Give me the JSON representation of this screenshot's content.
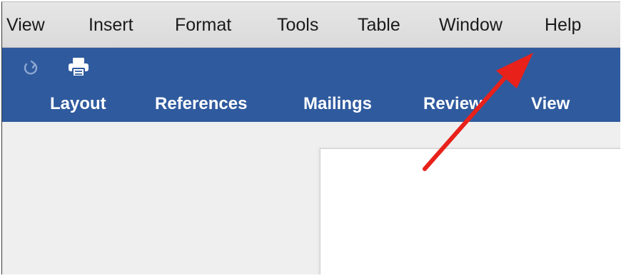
{
  "menubar": {
    "items": [
      "View",
      "Insert",
      "Format",
      "Tools",
      "Table",
      "Window",
      "Help"
    ]
  },
  "toolbar": {
    "quick_access": [
      {
        "icon": "redo-icon"
      },
      {
        "icon": "print-icon"
      }
    ],
    "tabs": [
      "Layout",
      "References",
      "Mailings",
      "Review",
      "View"
    ]
  },
  "colors": {
    "menubar_bg": "#dedede",
    "toolbar_bg": "#2f5a9e",
    "arrow": "#e8211a",
    "document_canvas": "#efefef",
    "page": "#ffffff"
  }
}
